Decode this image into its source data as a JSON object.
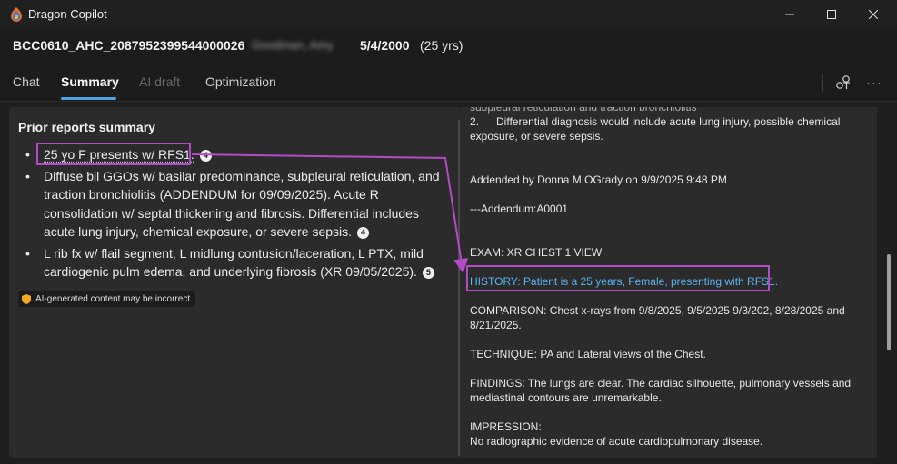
{
  "window": {
    "title": "Dragon Copilot",
    "minimize_glyph": "—",
    "maximize_glyph": "☐",
    "close_glyph": "✕"
  },
  "patient": {
    "id": "BCC0610_AHC_2087952399544000026",
    "name": "Goodman, Amy",
    "dob": "5/4/2000",
    "age": "(25 yrs)"
  },
  "tabs": [
    {
      "label": "Chat",
      "state": "normal"
    },
    {
      "label": "Summary",
      "state": "active"
    },
    {
      "label": "AI draft",
      "state": "disabled"
    },
    {
      "label": "Optimization",
      "state": "normal"
    }
  ],
  "toolbar": {
    "share_icon": "share-icon",
    "more_label": "···"
  },
  "summary": {
    "title": "Prior reports summary",
    "bullets": [
      {
        "text": "25 yo F presents w/ RFS1.",
        "cite": "4"
      },
      {
        "text": "Diffuse bil GGOs w/ basilar predominance, subpleural reticulation, and traction bronchiolitis (ADDENDUM for 09/09/2025). Acute R consolidation w/ septal thickening and fibrosis. Differential includes acute lung injury, chemical exposure, or severe sepsis.",
        "cite": "4"
      },
      {
        "text": "L rib fx w/ flail segment, L midlung contusion/laceration, L PTX, mild cardiogenic pulm edema, and underlying fibrosis (XR 09/05/2025).",
        "cite": "5"
      }
    ],
    "ai_notice": "AI-generated content may be incorrect"
  },
  "report": {
    "top_fragment": "subpleural reticulation and traction bronchiolitis",
    "item2_num": "2.",
    "item2_text": "Differential diagnosis would include acute lung injury, possible chemical exposure, or severe sepsis.",
    "addended_by": "Addended by Donna M OGrady on 9/9/2025 9:48 PM",
    "addendum_id": "---Addendum:A0001",
    "exam": "EXAM: XR CHEST 1 VIEW",
    "history": "HISTORY: Patient is a 25 years, Female, presenting with RFS1.",
    "comparison": "COMPARISON: Chest x-rays from 9/8/2025, 9/5/2025 9/3/202,  8/28/2025 and 8/21/2025.",
    "technique": "TECHNIQUE: PA and Lateral views of the Chest.",
    "findings": "FINDINGS: The lungs are clear. The cardiac silhouette, pulmonary vessels and mediastinal contours are unremarkable.",
    "impression_label": "IMPRESSION:",
    "impression": "No radiographic evidence of acute cardiopulmonary disease."
  },
  "colors": {
    "accent": "#4fa3e8",
    "highlight": "#b44bc6",
    "history_text": "#5ab4f0",
    "badge_shield": "#f5a623"
  }
}
